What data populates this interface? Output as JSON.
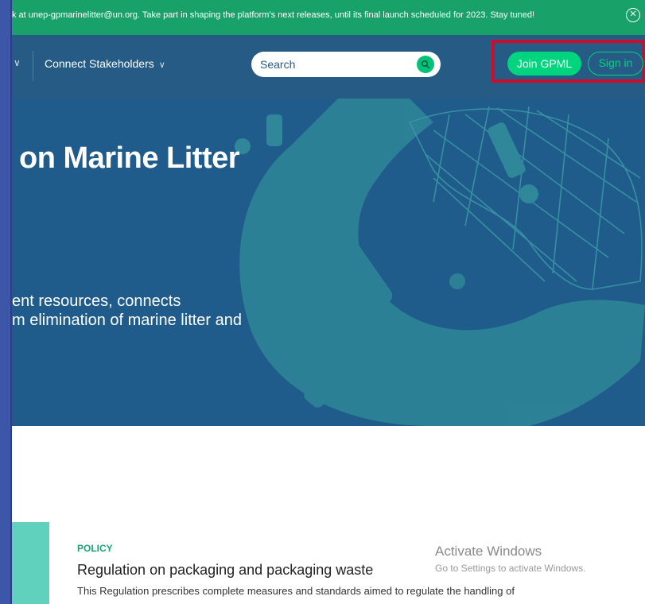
{
  "announcement": {
    "text": "k at unep-gpmarinelitter@un.org. Take part in shaping the platform’s next releases, until its final launch scheduled for 2023. Stay tuned!",
    "close_icon": "close-circle-icon"
  },
  "nav": {
    "item_label": "Connect Stakeholders",
    "chevron": "∨",
    "search": {
      "placeholder": "Search",
      "icon": "search-icon"
    },
    "join_label": "Join GPML",
    "signin_label": "Sign in"
  },
  "hero": {
    "title": "on Marine Litter",
    "line1": "ent resources, connects",
    "line2": "m elimination of marine litter and"
  },
  "card": {
    "tag": "POLICY",
    "title": "Regulation on packaging and packaging waste",
    "description": "This Regulation prescribes complete measures and standards aimed to regulate the handling of"
  },
  "watermark": {
    "title": "Activate Windows",
    "subtitle": "Go to Settings to activate Windows."
  },
  "colors": {
    "announce_bar": "#19a16a",
    "nav_bar": "#255b85",
    "hero_bg": "#1f5c8b",
    "accent_green": "#00d47f",
    "highlight_red": "#c8102e",
    "card_accent": "#5fd1bd"
  }
}
